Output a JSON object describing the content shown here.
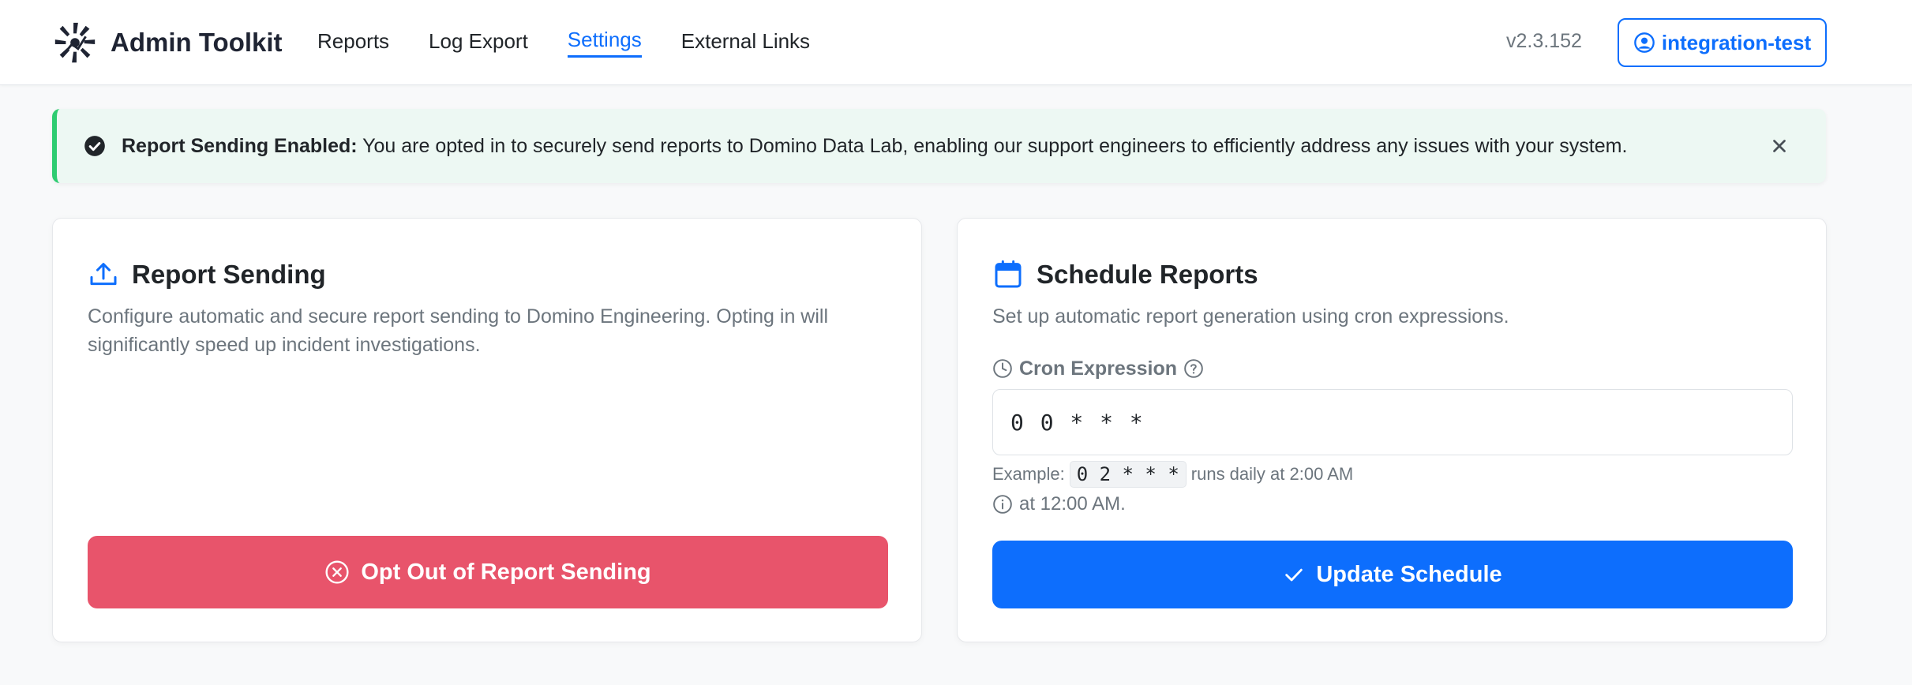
{
  "app": {
    "title": "Admin Toolkit",
    "version": "v2.3.152",
    "user": "integration-test"
  },
  "nav": {
    "items": [
      {
        "label": "Reports",
        "active": false
      },
      {
        "label": "Log Export",
        "active": false
      },
      {
        "label": "Settings",
        "active": true
      },
      {
        "label": "External Links",
        "active": false
      }
    ]
  },
  "alert": {
    "title": "Report Sending Enabled:",
    "message": "You are opted in to securely send reports to Domino Data Lab, enabling our support engineers to efficiently address any issues with your system."
  },
  "report_sending": {
    "title": "Report Sending",
    "description": "Configure automatic and secure report sending to Domino Engineering. Opting in will significantly speed up incident investigations.",
    "button_label": "Opt Out of Report Sending"
  },
  "schedule": {
    "title": "Schedule Reports",
    "description": "Set up automatic report generation using cron expressions.",
    "cron_label": "Cron Expression",
    "cron_value": "0 0 * * *",
    "example_prefix": "Example:",
    "example_code": "0 2 * * *",
    "example_suffix": "runs daily at 2:00 AM",
    "next_run": "at 12:00 AM.",
    "button_label": "Update Schedule"
  },
  "colors": {
    "primary": "#0d6efd",
    "danger": "#e8546b",
    "success_border": "#2ecc71",
    "success_bg": "#edf8f3"
  }
}
